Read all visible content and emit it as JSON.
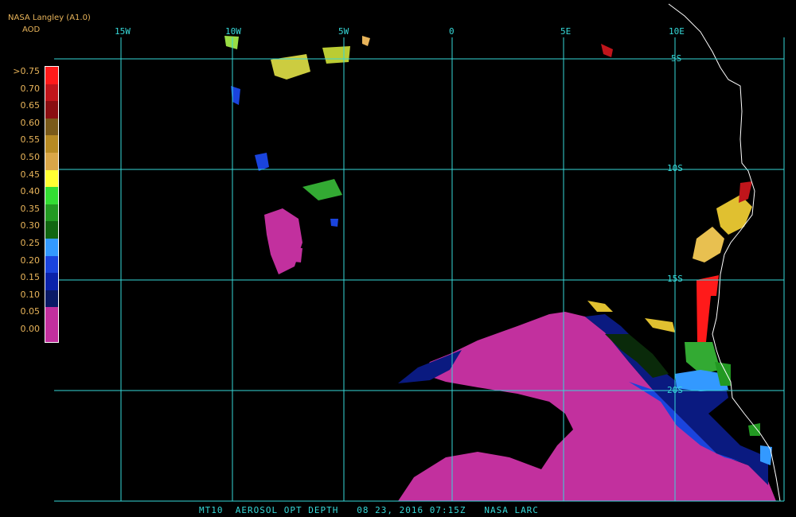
{
  "header": {
    "brand": "NASA Langley (A1.0)",
    "variable": "AOD"
  },
  "color_scale": {
    "labels": [
      ">0.75",
      "0.70",
      "0.65",
      "0.60",
      "0.55",
      "0.50",
      "0.45",
      "0.40",
      "0.35",
      "0.30",
      "0.25",
      "0.20",
      "0.15",
      "0.10",
      "0.05",
      "0.00"
    ],
    "colors": [
      "#ff1a1a",
      "#c0151b",
      "#8a0e12",
      "#7a5a1a",
      "#b78a23",
      "#d9a648",
      "#ffff33",
      "#33dd33",
      "#229922",
      "#116611",
      "#3399ff",
      "#1a44dd",
      "#0a22aa",
      "#0a1a66",
      "#c2309e",
      "#c2309e"
    ]
  },
  "grid": {
    "longitudes": [
      "15W",
      "10W",
      "5W",
      "0",
      "5E",
      "10E"
    ],
    "latitudes": [
      "5S",
      "10S",
      "15S",
      "20S"
    ],
    "color": "#36d8d8"
  },
  "footer": {
    "product": "MT10",
    "title": "AEROSOL OPT DEPTH",
    "date": "08 23, 2016",
    "time": "07:15Z",
    "source": "NASA LARC"
  }
}
